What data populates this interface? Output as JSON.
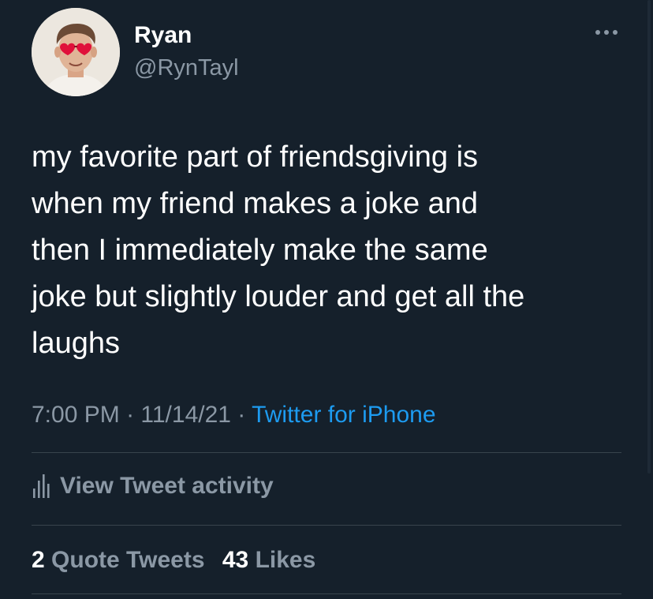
{
  "theme": {
    "background": "#15202b",
    "text_primary": "#ffffff",
    "text_secondary": "#8b98a5",
    "link": "#1d9bf0",
    "divider": "#38444d"
  },
  "author": {
    "display_name": "Ryan",
    "handle": "@RynTayl",
    "avatar_icon": "profile-photo-with-red-heart-sunglasses"
  },
  "tweet": {
    "text": "my favorite part of friendsgiving is\nwhen my friend makes a joke and\nthen I immediately make the same\njoke but slightly louder and get all the\nlaughs",
    "time": "7:00 PM",
    "date": "11/14/21",
    "separator": " · ",
    "source": "Twitter for iPhone"
  },
  "activity": {
    "icon": "bar-chart-icon",
    "label": "View Tweet activity"
  },
  "stats": {
    "quote_tweets_count": "2",
    "quote_tweets_label": "Quote Tweets",
    "likes_count": "43",
    "likes_label": "Likes"
  },
  "menu": {
    "icon": "more-options-icon"
  }
}
